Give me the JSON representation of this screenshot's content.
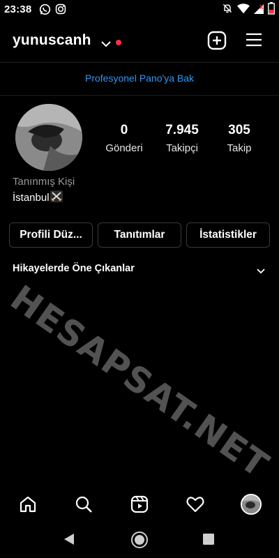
{
  "status_bar": {
    "time": "23:38",
    "left_icons": [
      "whatsapp-icon",
      "instagram-icon"
    ],
    "right_icons": [
      "mute-icon",
      "wifi-icon",
      "signal-icon",
      "battery-icon"
    ]
  },
  "header": {
    "username": "yunuscanh",
    "icons": [
      "chevron-down-icon",
      "new-post-icon",
      "menu-icon"
    ],
    "notification_dot_color": "#ff3040"
  },
  "pro_dashboard": {
    "label": "Profesyonel Pano'ya Bak",
    "color": "#2e97f5"
  },
  "profile": {
    "stats": [
      {
        "value": "0",
        "label": "Gönderi"
      },
      {
        "value": "7.945",
        "label": "Takipçi"
      },
      {
        "value": "305",
        "label": "Takip"
      }
    ],
    "category": "Tanınmış Kişi",
    "bio": "İstanbul",
    "bio_emoji": "crossed-swords-icon"
  },
  "actions": {
    "edit_profile": "Profili Düz...",
    "promotions": "Tanıtımlar",
    "insights": "İstatistikler"
  },
  "highlights": {
    "title": "Hikayelerde Öne Çıkanlar"
  },
  "watermark": "HESAPSAT.NET",
  "bottom_nav": [
    "home-icon",
    "search-icon",
    "reels-icon",
    "heart-icon",
    "profile-avatar"
  ],
  "system_nav": [
    "back-icon",
    "home-circle-icon",
    "recents-icon"
  ]
}
